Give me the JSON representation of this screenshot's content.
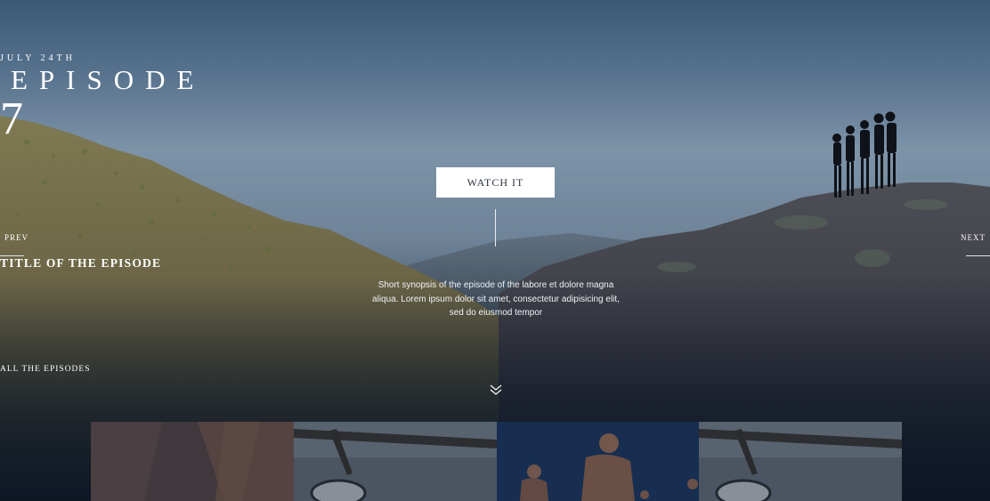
{
  "episode": {
    "date": "JULY 24TH",
    "label": "EPISODE",
    "number": "7",
    "watch_label": "WATCH IT",
    "title": "TITLE OF THE EPISODE",
    "synopsis": "Short synopsis of the episode of the labore et dolore magna aliqua. Lorem ipsum dolor sit amet, consectetur adipisicing elit, sed do eiusmod tempor"
  },
  "nav": {
    "prev_label": "PREV",
    "next_label": "NEXT"
  },
  "episodes_link": {
    "label": "ALL THE EPISODES",
    "icon": "double-chevron-down-icon"
  },
  "thumbnails": [
    {
      "name": "canyon-rock"
    },
    {
      "name": "helmet-branch"
    },
    {
      "name": "runners-blue"
    },
    {
      "name": "helmet-branch-2"
    }
  ],
  "colors": {
    "button_bg": "#ffffff",
    "button_text": "#2b3340",
    "accent_text": "#ffffff"
  }
}
